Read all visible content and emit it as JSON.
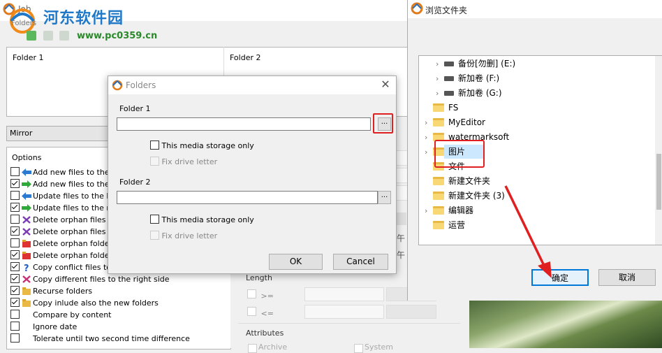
{
  "main": {
    "title": "Job",
    "watermark": {
      "name": "河东软件园",
      "url": "www.pc0359.cn"
    },
    "folders_group_label": "Folders",
    "folder1_header": "Folder 1",
    "folder2_header": "Folder 2",
    "mode": "Mirror",
    "options_title": "Options",
    "options": [
      {
        "label": "Add new files to the left",
        "checked": false,
        "icon": "arrow-left-add-icon"
      },
      {
        "label": "Add new files to the right",
        "checked": true,
        "icon": "arrow-right-add-icon"
      },
      {
        "label": "Update files to the left",
        "checked": false,
        "icon": "arrow-left-update-icon"
      },
      {
        "label": "Update files to the right",
        "checked": true,
        "icon": "arrow-right-update-icon"
      },
      {
        "label": "Delete orphan files into",
        "checked": false,
        "icon": "delete-cross-icon"
      },
      {
        "label": "Delete orphan files into",
        "checked": true,
        "icon": "delete-cross-icon"
      },
      {
        "label": "Delete orphan folders i",
        "checked": false,
        "icon": "delete-folder-icon"
      },
      {
        "label": "Delete orphan folders i",
        "checked": true,
        "icon": "delete-folder-icon"
      },
      {
        "label": "Copy conflict files to th",
        "checked": true,
        "icon": "question-icon"
      },
      {
        "label": "Copy different files to the right side",
        "checked": true,
        "icon": "copy-different-icon"
      },
      {
        "label": "Recurse folders",
        "checked": true,
        "icon": "folder-icon"
      },
      {
        "label": "Copy inlude also the new folders",
        "checked": true,
        "icon": "new-folder-icon"
      },
      {
        "label": "Compare by content",
        "checked": false,
        "icon": ""
      },
      {
        "label": "Ignore date",
        "checked": false,
        "icon": ""
      },
      {
        "label": "Tolerate until two second time difference",
        "checked": false,
        "icon": ""
      }
    ],
    "filter_length_label": "Length",
    "length_ge": ">=",
    "length_le": "<=",
    "attributes_label": "Attributes",
    "archive_label": "Archive",
    "system_label": "System",
    "zh_stub": "午"
  },
  "folders_dialog": {
    "title": "Folders",
    "folder1_label": "Folder 1",
    "folder1_value": "",
    "folder2_label": "Folder 2",
    "folder2_value": "",
    "browse_label": "...",
    "media_only_label": "This media storage only",
    "fix_drive_label": "Fix drive letter",
    "ok_label": "OK",
    "cancel_label": "Cancel"
  },
  "browse_dialog": {
    "title": "浏览文件夹",
    "tree": [
      {
        "label": "备份[勿删] (E:)",
        "type": "drive",
        "expandable": true,
        "indent": 1
      },
      {
        "label": "新加卷 (F:)",
        "type": "drive",
        "expandable": true,
        "indent": 1
      },
      {
        "label": "新加卷 (G:)",
        "type": "drive",
        "expandable": true,
        "indent": 1
      },
      {
        "label": "FS",
        "type": "folder",
        "expandable": false,
        "indent": 0
      },
      {
        "label": "MyEditor",
        "type": "folder",
        "expandable": true,
        "indent": 0
      },
      {
        "label": "watermarksoft",
        "type": "folder",
        "expandable": true,
        "indent": 0
      },
      {
        "label": "图片",
        "type": "folder",
        "expandable": true,
        "indent": 0,
        "selected": true
      },
      {
        "label": "文件",
        "type": "folder",
        "expandable": false,
        "indent": 0
      },
      {
        "label": "新建文件夹",
        "type": "folder",
        "expandable": false,
        "indent": 0
      },
      {
        "label": "新建文件夹 (3)",
        "type": "folder",
        "expandable": false,
        "indent": 0
      },
      {
        "label": "编辑器",
        "type": "folder",
        "expandable": true,
        "indent": 0
      },
      {
        "label": "运营",
        "type": "folder",
        "expandable": false,
        "indent": 0
      }
    ],
    "ok_label": "确定",
    "cancel_label": "取消"
  },
  "colors": {
    "highlight": "#e02020",
    "selection": "#cce8ff",
    "accent": "#0078d7",
    "watermark": "#1f78c8"
  }
}
